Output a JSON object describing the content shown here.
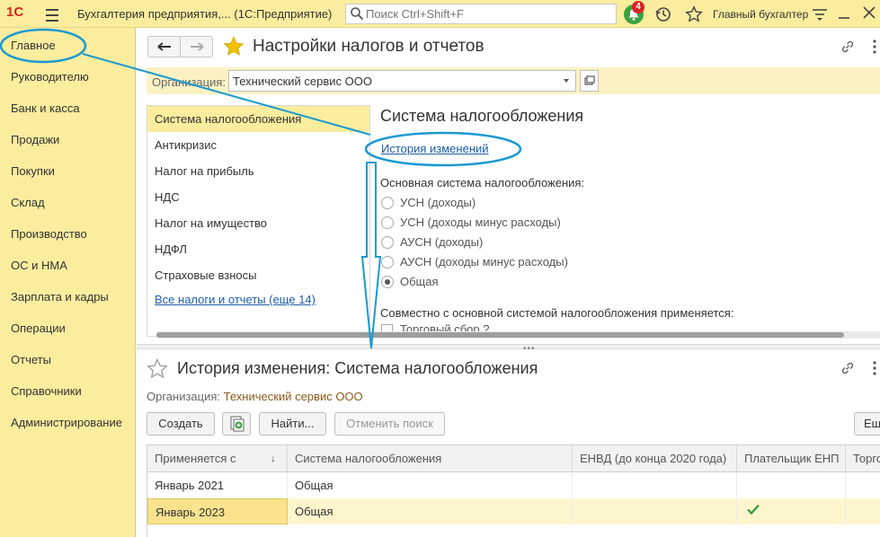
{
  "topbar": {
    "logo": "1С",
    "title": "Бухгалтерия предприятия,... (1С:Предприятие)",
    "search_placeholder": "Поиск Ctrl+Shift+F",
    "notifications_count": "4",
    "user": "Главный бухгалтер"
  },
  "sidebar": {
    "items": [
      {
        "label": "Главное"
      },
      {
        "label": "Руководителю"
      },
      {
        "label": "Банк и касса"
      },
      {
        "label": "Продажи"
      },
      {
        "label": "Покупки"
      },
      {
        "label": "Склад"
      },
      {
        "label": "Производство"
      },
      {
        "label": "ОС и НМА"
      },
      {
        "label": "Зарплата и кадры"
      },
      {
        "label": "Операции"
      },
      {
        "label": "Отчеты"
      },
      {
        "label": "Справочники"
      },
      {
        "label": "Администрирование"
      }
    ]
  },
  "upper_form": {
    "title": "Настройки налогов и отчетов",
    "org_label": "Организация:",
    "org_value": "Технический сервис ООО",
    "sections": [
      {
        "label": "Система налогообложения",
        "selected": true
      },
      {
        "label": "Антикризис"
      },
      {
        "label": "Налог на прибыль"
      },
      {
        "label": "НДС"
      },
      {
        "label": "Налог на имущество"
      },
      {
        "label": "НДФЛ"
      },
      {
        "label": "Страховые взносы"
      }
    ],
    "all_taxes_link": "Все налоги и отчеты (еще 14)",
    "section_title": "Система налогообложения",
    "history_link": "История изменений",
    "main_system_label": "Основная система налогообложения:",
    "options": [
      {
        "label": "УСН (доходы)",
        "checked": false
      },
      {
        "label": "УСН (доходы минус расходы)",
        "checked": false
      },
      {
        "label": "АУСН (доходы)",
        "checked": false
      },
      {
        "label": "АУСН (доходы минус расходы)",
        "checked": false
      },
      {
        "label": "Общая",
        "checked": true
      }
    ],
    "also_label": "Совместно с основной системой налогообложения применяется:",
    "cut_item": "Торговый сбор ?"
  },
  "lower_form": {
    "title": "История изменения: Система налогообложения",
    "org_label": "Организация:",
    "org_value": "Технический сервис ООО",
    "buttons": {
      "create": "Создать",
      "find": "Найти...",
      "cancel_search": "Отменить поиск",
      "more": "Ещ"
    },
    "columns": [
      "Применяется с",
      "Система налогообложения",
      "ЕНВД (до конца 2020 года)",
      "Плательщик ЕНП",
      "Торго"
    ],
    "rows": [
      {
        "from": "Январь 2021",
        "system": "Общая",
        "envd": "",
        "enp": false
      },
      {
        "from": "Январь 2023",
        "system": "Общая",
        "envd": "",
        "enp": true
      }
    ]
  },
  "colors": {
    "panel_yellow": "#fbed9e",
    "link_blue": "#1d5ea8",
    "annotation_blue": "#1b9ad1",
    "check_green": "#2e9b3b"
  }
}
